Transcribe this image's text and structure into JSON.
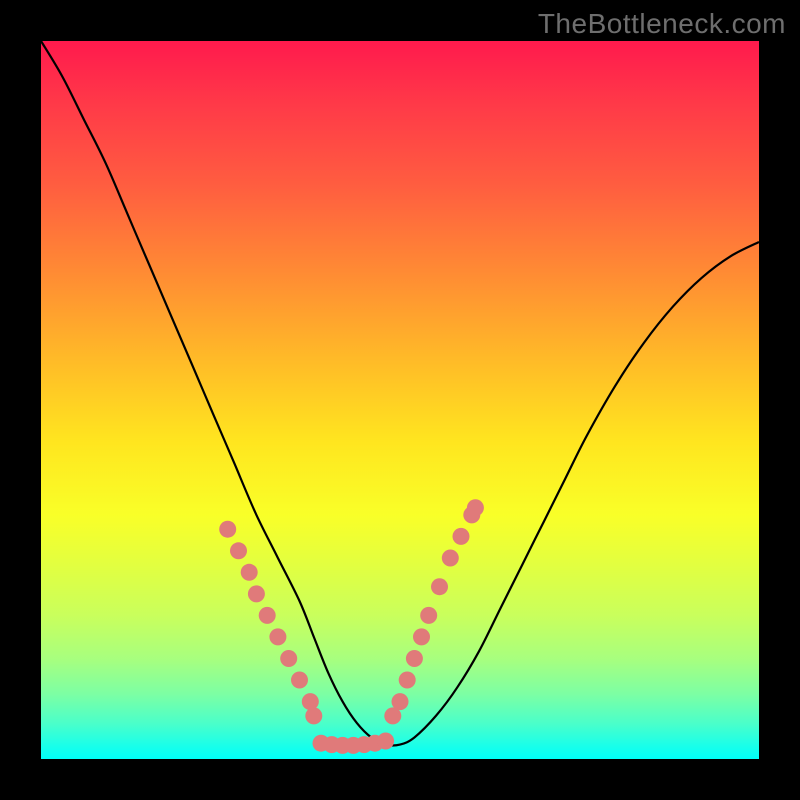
{
  "watermark": "TheBottleneck.com",
  "colors": {
    "gradient_top": "#ff1a4d",
    "gradient_bottom": "#00fff9",
    "curve": "#000000",
    "marker": "#e07a7a",
    "frame": "#000000"
  },
  "chart_data": {
    "type": "line",
    "title": "",
    "xlabel": "",
    "ylabel": "",
    "xlim": [
      0,
      100
    ],
    "ylim": [
      0,
      100
    ],
    "x": [
      0,
      3,
      6,
      9,
      12,
      15,
      18,
      21,
      24,
      27,
      30,
      33,
      36,
      38,
      40,
      42,
      44,
      46,
      48,
      50,
      52,
      55,
      58,
      61,
      64,
      67,
      70,
      73,
      76,
      80,
      84,
      88,
      92,
      96,
      100
    ],
    "y": [
      100,
      95,
      89,
      83,
      76,
      69,
      62,
      55,
      48,
      41,
      34,
      28,
      22,
      17,
      12,
      8,
      5,
      3,
      2,
      2,
      3,
      6,
      10,
      15,
      21,
      27,
      33,
      39,
      45,
      52,
      58,
      63,
      67,
      70,
      72
    ],
    "markers_left": {
      "x": [
        26.0,
        27.5,
        29.0,
        30.0,
        31.5,
        33.0,
        34.5,
        36.0,
        37.5,
        38.0
      ],
      "y": [
        32.0,
        29.0,
        26.0,
        23.0,
        20.0,
        17.0,
        14.0,
        11.0,
        8.0,
        6.0
      ]
    },
    "markers_right": {
      "x": [
        49.0,
        50.0,
        51.0,
        52.0,
        53.0,
        54.0,
        55.5,
        57.0,
        58.5,
        60.0,
        60.5
      ],
      "y": [
        6.0,
        8.0,
        11.0,
        14.0,
        17.0,
        20.0,
        24.0,
        28.0,
        31.0,
        34.0,
        35.0
      ]
    },
    "markers_bottom": {
      "x": [
        39.0,
        40.5,
        42.0,
        43.5,
        45.0,
        46.5,
        48.0
      ],
      "y": [
        2.2,
        2.0,
        1.9,
        1.9,
        2.0,
        2.2,
        2.5
      ]
    }
  }
}
